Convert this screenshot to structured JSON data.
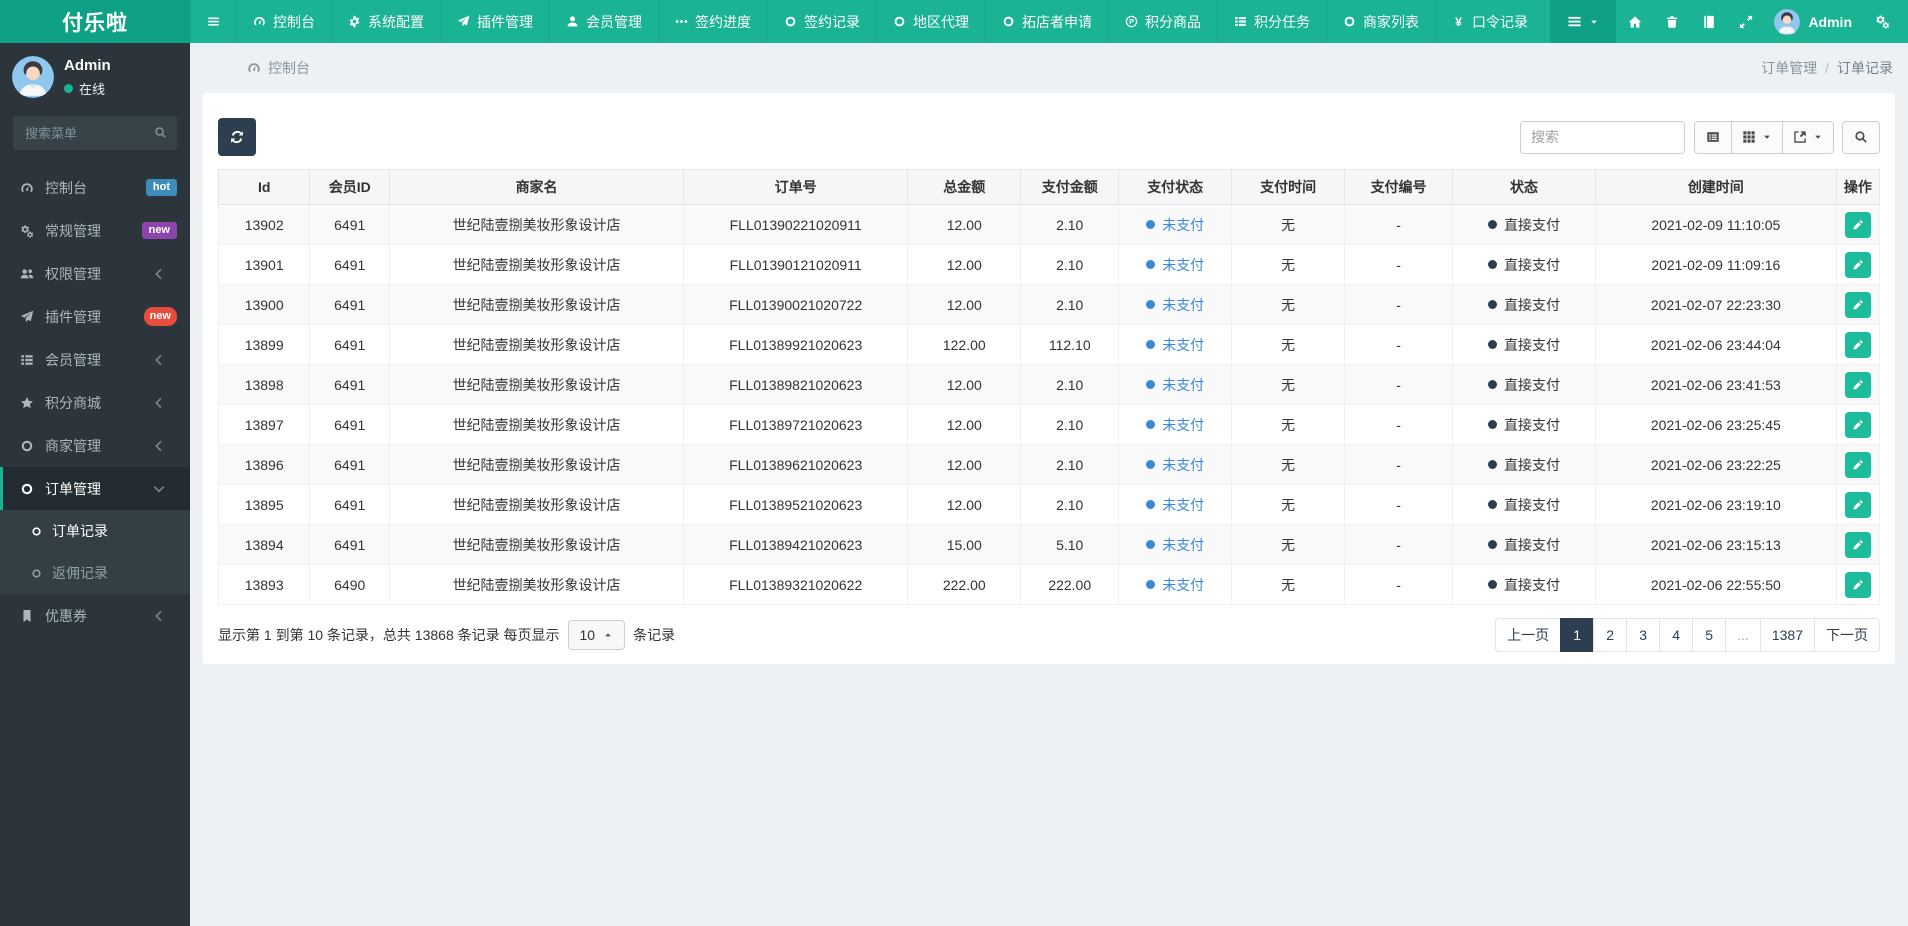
{
  "brand": "付乐啦",
  "navbar": {
    "items": [
      {
        "icon": "bars",
        "label": ""
      },
      {
        "icon": "gauge",
        "label": "控制台"
      },
      {
        "icon": "gear",
        "label": "系统配置"
      },
      {
        "icon": "plane",
        "label": "插件管理"
      },
      {
        "icon": "user",
        "label": "会员管理"
      },
      {
        "icon": "ellipsis",
        "label": "签约进度"
      },
      {
        "icon": "circle",
        "label": "签约记录"
      },
      {
        "icon": "circle",
        "label": "地区代理"
      },
      {
        "icon": "circle",
        "label": "拓店者申请"
      },
      {
        "icon": "p-circle",
        "label": "积分商品"
      },
      {
        "icon": "list",
        "label": "积分任务"
      },
      {
        "icon": "circle",
        "label": "商家列表"
      },
      {
        "icon": "yen",
        "label": "口令记录"
      }
    ],
    "right_icons": [
      "home",
      "trash",
      "book",
      "expand"
    ],
    "user": "Admin"
  },
  "sidebar": {
    "profile": {
      "name": "Admin",
      "status": "在线"
    },
    "search_placeholder": "搜索菜单",
    "menu": [
      {
        "icon": "gauge",
        "label": "控制台",
        "badge": "hot",
        "badge_color": "#3c8dbc"
      },
      {
        "icon": "gears",
        "label": "常规管理",
        "badge": "new",
        "badge_color": "#8e44ad"
      },
      {
        "icon": "users",
        "label": "权限管理",
        "expand": true
      },
      {
        "icon": "plane",
        "label": "插件管理",
        "badge": "new",
        "badge_color": "#e74c3c",
        "badge_pill": true
      },
      {
        "icon": "list",
        "label": "会员管理",
        "expand": true
      },
      {
        "icon": "star",
        "label": "积分商城",
        "expand": true
      },
      {
        "icon": "circle",
        "label": "商家管理",
        "expand": true
      },
      {
        "icon": "circle",
        "label": "订单管理",
        "expand": true,
        "open": true,
        "active": true,
        "children": [
          {
            "icon": "circle",
            "label": "订单记录",
            "active": true
          },
          {
            "icon": "circle",
            "label": "返佣记录"
          }
        ]
      },
      {
        "icon": "bookmark",
        "label": "优惠券",
        "expand": true
      }
    ]
  },
  "breadcrumb": {
    "left": "控制台",
    "parent": "订单管理",
    "separator": "/",
    "current": "订单记录"
  },
  "toolbar": {
    "search_placeholder": "搜索",
    "buttons": [
      {
        "icon": "list-alt",
        "caret": false
      },
      {
        "icon": "grid",
        "caret": true
      },
      {
        "icon": "export",
        "caret": true
      }
    ],
    "search_button_icon": "search"
  },
  "table": {
    "columns": [
      "Id",
      "会员ID",
      "商家名",
      "订单号",
      "总金额",
      "支付金额",
      "支付状态",
      "支付时间",
      "支付编号",
      "状态",
      "创建时间",
      "操作"
    ],
    "pay_status_color": "#3789d8",
    "status_dot_color": "#2c3e50",
    "rows": [
      [
        "13902",
        "6491",
        "世纪陆壹捌美妆形象设计店",
        "FLL01390221020911",
        "12.00",
        "2.10",
        "未支付",
        "无",
        "-",
        "直接支付",
        "2021-02-09 11:10:05"
      ],
      [
        "13901",
        "6491",
        "世纪陆壹捌美妆形象设计店",
        "FLL01390121020911",
        "12.00",
        "2.10",
        "未支付",
        "无",
        "-",
        "直接支付",
        "2021-02-09 11:09:16"
      ],
      [
        "13900",
        "6491",
        "世纪陆壹捌美妆形象设计店",
        "FLL01390021020722",
        "12.00",
        "2.10",
        "未支付",
        "无",
        "-",
        "直接支付",
        "2021-02-07 22:23:30"
      ],
      [
        "13899",
        "6491",
        "世纪陆壹捌美妆形象设计店",
        "FLL01389921020623",
        "122.00",
        "112.10",
        "未支付",
        "无",
        "-",
        "直接支付",
        "2021-02-06 23:44:04"
      ],
      [
        "13898",
        "6491",
        "世纪陆壹捌美妆形象设计店",
        "FLL01389821020623",
        "12.00",
        "2.10",
        "未支付",
        "无",
        "-",
        "直接支付",
        "2021-02-06 23:41:53"
      ],
      [
        "13897",
        "6491",
        "世纪陆壹捌美妆形象设计店",
        "FLL01389721020623",
        "12.00",
        "2.10",
        "未支付",
        "无",
        "-",
        "直接支付",
        "2021-02-06 23:25:45"
      ],
      [
        "13896",
        "6491",
        "世纪陆壹捌美妆形象设计店",
        "FLL01389621020623",
        "12.00",
        "2.10",
        "未支付",
        "无",
        "-",
        "直接支付",
        "2021-02-06 23:22:25"
      ],
      [
        "13895",
        "6491",
        "世纪陆壹捌美妆形象设计店",
        "FLL01389521020623",
        "12.00",
        "2.10",
        "未支付",
        "无",
        "-",
        "直接支付",
        "2021-02-06 23:19:10"
      ],
      [
        "13894",
        "6491",
        "世纪陆壹捌美妆形象设计店",
        "FLL01389421020623",
        "15.00",
        "5.10",
        "未支付",
        "无",
        "-",
        "直接支付",
        "2021-02-06 23:15:13"
      ],
      [
        "13893",
        "6490",
        "世纪陆壹捌美妆形象设计店",
        "FLL01389321020622",
        "222.00",
        "222.00",
        "未支付",
        "无",
        "-",
        "直接支付",
        "2021-02-06 22:55:50"
      ]
    ]
  },
  "footer": {
    "summary_prefix": "显示第 1 到第 10 条记录，总共 13868 条记录 每页显示",
    "page_size": "10",
    "summary_suffix": "条记录",
    "pagination": [
      {
        "label": "上一页"
      },
      {
        "label": "1",
        "active": true
      },
      {
        "label": "2"
      },
      {
        "label": "3"
      },
      {
        "label": "4"
      },
      {
        "label": "5"
      },
      {
        "label": "...",
        "disabled": true
      },
      {
        "label": "1387"
      },
      {
        "label": "下一页"
      }
    ]
  },
  "colors": {
    "navbar": "#1ab394",
    "navbar_dark": "#0fa185",
    "sidebar": "#2b353b",
    "accent": "#1ab394",
    "refresh_button": "#2c3e50",
    "edit_button": "#1dbc9c",
    "pagination_active": "#2c3e50",
    "pay_status_blue": "#3789d8"
  }
}
